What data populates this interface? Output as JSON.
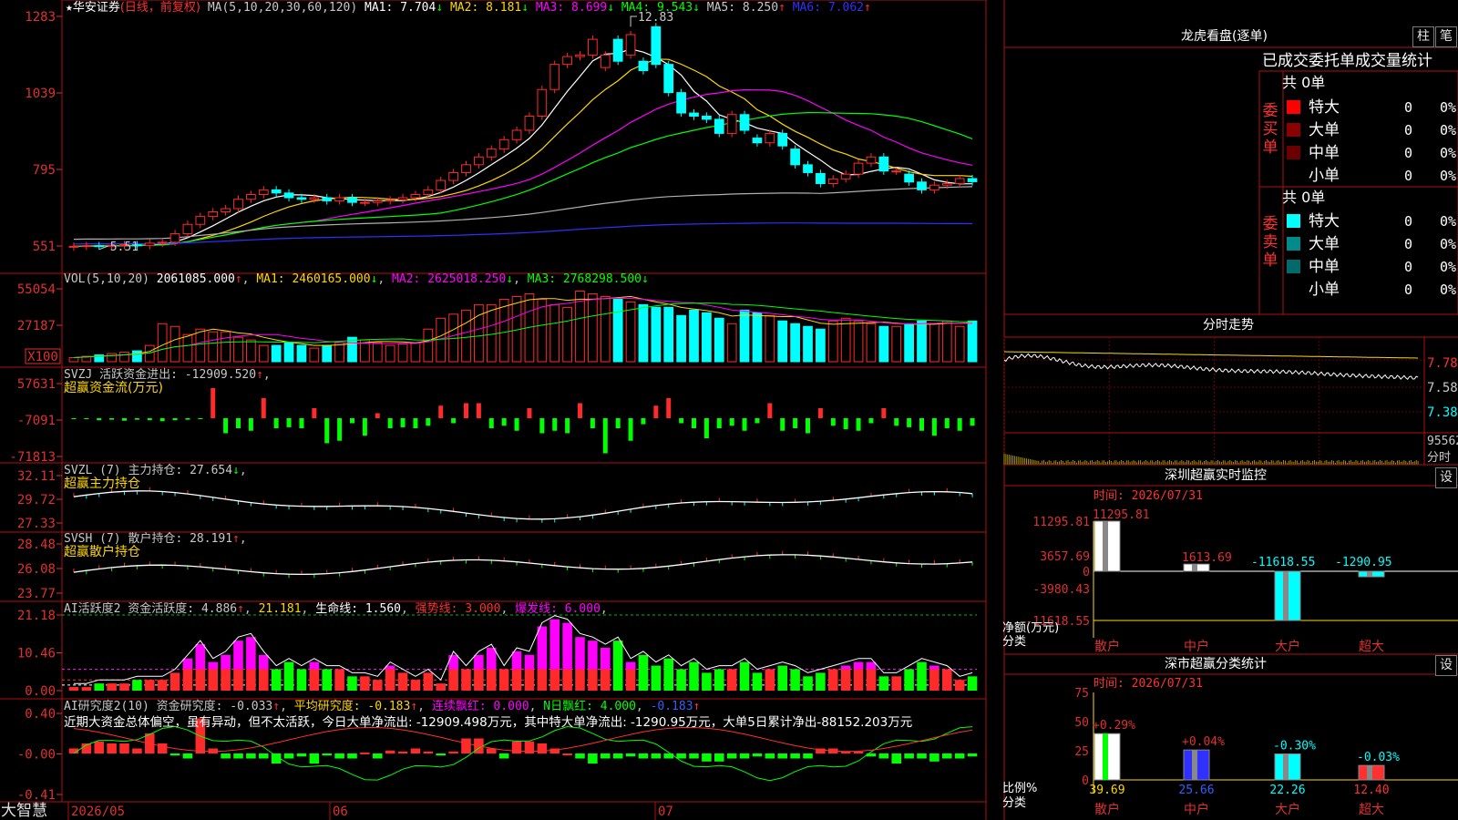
{
  "colors": {
    "up": "#ff2a2a",
    "down": "#00ffff",
    "border": "#b01010",
    "grid": "#6a0000",
    "label": "#e03030",
    "text": "#c8c8c8",
    "yellow": "#ffd700",
    "magenta": "#ff00ff",
    "green": "#00ff00",
    "white": "#ffffff",
    "blue": "#3030ff"
  },
  "header": {
    "star": "★",
    "stock": "华安证券",
    "mode": "(日线，前复权)",
    "ma_title": "MA(5,10,20,30,60,120)",
    "ma1": "MA1: 7.704",
    "ma1_arrow": "↓",
    "ma2": "MA2: 8.181",
    "ma2_arrow": "↓",
    "ma3": "MA3: 8.699",
    "ma3_arrow": "↓",
    "ma4": "MA4: 9.543",
    "ma4_arrow": "↓",
    "ma5": "MA5: 8.250",
    "ma5_arrow": "↑",
    "ma6": "MA6: 7.062",
    "ma6_arrow": "↑"
  },
  "price_axis": [
    "1283",
    "1039",
    "795",
    "551"
  ],
  "price_high_label": "12.83",
  "price_low_label": "5.51",
  "vol": {
    "title": "VOL(5,10,20)",
    "value": "2061085.000",
    "arrow": "↑",
    "ma1": "MA1: 2460165.000",
    "ma1_arrow": "↓",
    "ma2": "MA2: 2625018.250",
    "ma2_arrow": "↓",
    "ma3": "MA3: 2768298.500",
    "ma3_arrow": "↓",
    "axis": [
      "55054",
      "27187"
    ],
    "unit": "X100"
  },
  "svzj": {
    "title": "SVZJ  活跃资金进出: -12909.520",
    "arrow": "↑",
    "sub": "超赢资金流(万元)",
    "axis": [
      "57631",
      "-7091",
      "-71813"
    ]
  },
  "svzl": {
    "title": "SVZL (7) 主力持仓: 27.654",
    "arrow": "↓",
    "sub": "超赢主力持仓",
    "axis": [
      "32.11",
      "29.72",
      "27.33"
    ]
  },
  "svsh": {
    "title": "SVSH (7) 散户持仓: 28.191",
    "arrow": "↑",
    "sub": "超赢散户持仓",
    "axis": [
      "28.48",
      "26.08",
      "23.77"
    ]
  },
  "ai1": {
    "title": "AI活跃度2 资金活跃度: 4.886",
    "a1": "↑",
    "v2": "21.181",
    "sep": ",",
    "v3": "生命线: 1.560",
    "v4": "强势线: 3.000",
    "v5": "爆发线: 6.000",
    "axis": [
      "21.18",
      "10.46",
      "0.00"
    ]
  },
  "ai2": {
    "title": "AI研究度2(10) 资金研究度: -0.033",
    "a1": "↑",
    "v2": "平均研究度: -0.183",
    "a2": "↑",
    "v3": "连续飘红: 0.000",
    "v4": "N日飘红: 4.000",
    "v5": "-0.183",
    "a5": "↑",
    "comment": "近期大资金总体偏空，虽有异动，但不太活跃，今日大单净流出: -12909.498万元，其中特大单净流出: -1290.95万元，大单5日累计净出-88152.203万元",
    "axis": [
      "0.40",
      "-0.00",
      "-0.41"
    ]
  },
  "footer": {
    "brand": "大智慧",
    "dates": [
      "2026/05",
      "06",
      "07"
    ]
  },
  "right": {
    "lh_title": "龙虎看盘(逐单)",
    "btn_zhu": "柱",
    "btn_bi": "笔",
    "stats_title": "已成交委托单成交量统计",
    "buy_label": "委买单",
    "sell_label": "委卖单",
    "buy_total": "共 0单",
    "sell_total": "共 0单",
    "rows": [
      {
        "name": "特大",
        "v": "0",
        "p": "0%"
      },
      {
        "name": "大单",
        "v": "0",
        "p": "0%"
      },
      {
        "name": "中单",
        "v": "0",
        "p": "0%"
      },
      {
        "name": "小单",
        "v": "0",
        "p": "0%"
      }
    ],
    "intraday_title": "分时走势",
    "intraday_axis": [
      "7.78",
      "7.58",
      "7.38"
    ],
    "intraday_vol": "95562",
    "intraday_unit": "分时",
    "sz_title": "深圳超赢实时监控",
    "sz_time": "时间: 2026/07/31",
    "sz_btn": "设",
    "sz_axis": [
      "11295.81",
      "3657.69",
      "0",
      "-3980.43",
      "-11618.55"
    ],
    "sz_unit": "净额(万元)",
    "sz_cat_label": "分类",
    "cls_title": "深市超赢分类统计",
    "cls_time": "时间: 2026/07/31",
    "cls_btn": "设",
    "cls_axis": [
      "75",
      "50",
      "25",
      "0"
    ],
    "cls_unit": "比例%",
    "cls_cat_label": "分类"
  },
  "chart_data": [
    {
      "type": "candlestick",
      "title": "华安证券(日线，前复权)",
      "open": [
        5.48,
        5.5,
        5.52,
        5.51,
        5.53,
        5.55,
        5.52,
        5.6,
        5.63,
        5.9,
        6.2,
        6.45,
        6.6,
        6.7,
        7.0,
        7.15,
        7.3,
        7.2,
        7.05,
        7.0,
        7.05,
        6.95,
        7.05,
        6.9,
        6.9,
        6.95,
        6.98,
        7.05,
        7.15,
        7.3,
        7.6,
        7.85,
        8.1,
        8.35,
        8.6,
        8.9,
        9.2,
        9.65,
        10.5,
        11.3,
        11.55,
        11.6,
        11.2,
        12.1,
        11.6,
        11.4,
        12.5,
        11.3,
        10.4,
        9.75,
        9.65,
        9.55,
        9.1,
        9.7,
        8.95,
        8.8,
        9.1,
        8.6,
        8.1,
        7.82,
        7.5,
        7.65,
        7.8,
        8.15,
        8.35,
        7.9,
        7.8,
        7.55,
        7.3,
        7.45,
        7.5,
        7.66
      ],
      "close": [
        5.5,
        5.52,
        5.51,
        5.53,
        5.55,
        5.52,
        5.6,
        5.63,
        5.9,
        6.2,
        6.45,
        6.6,
        6.7,
        7.0,
        7.15,
        7.3,
        7.2,
        7.05,
        7.0,
        7.05,
        6.95,
        7.05,
        6.9,
        6.9,
        6.95,
        6.98,
        7.05,
        7.15,
        7.3,
        7.6,
        7.85,
        8.1,
        8.35,
        8.6,
        8.9,
        9.2,
        9.65,
        10.5,
        11.3,
        11.55,
        11.6,
        12.1,
        11.6,
        11.4,
        12.25,
        11.1,
        11.3,
        10.4,
        9.75,
        9.65,
        9.55,
        9.1,
        9.7,
        9.2,
        8.8,
        9.1,
        8.7,
        8.1,
        7.85,
        7.5,
        7.65,
        7.8,
        8.15,
        8.35,
        7.9,
        7.9,
        7.55,
        7.3,
        7.45,
        7.5,
        7.66,
        7.56
      ],
      "ylim": [
        5.51,
        12.83
      ]
    },
    {
      "type": "bar",
      "title": "VOL(5,10,20)",
      "series": [
        {
          "name": "VOL",
          "values": [
            3,
            4,
            5,
            6,
            7,
            8,
            12,
            28,
            26,
            20,
            24,
            22,
            22,
            18,
            16,
            12,
            12,
            14,
            12,
            10,
            12,
            14,
            18,
            16,
            14,
            12,
            13,
            14,
            24,
            32,
            35,
            38,
            42,
            42,
            46,
            48,
            50,
            46,
            42,
            40,
            52,
            50,
            48,
            46,
            44,
            42,
            40,
            40,
            34,
            38,
            36,
            32,
            28,
            38,
            36,
            34,
            30,
            28,
            26,
            24,
            30,
            32,
            30,
            28,
            26,
            26,
            28,
            30,
            28,
            30,
            26,
            30
          ]
        }
      ],
      "unit": "X100",
      "axis_max": 55054
    },
    {
      "type": "bar",
      "title": "SVZJ 活跃资金进出",
      "series": [
        {
          "name": "超赢资金流(万元)",
          "values": [
            -2,
            -2,
            -4,
            -3,
            -5,
            -3,
            -4,
            -6,
            -4,
            -3,
            -2,
            60,
            -30,
            -20,
            -25,
            40,
            -20,
            -18,
            -20,
            20,
            -50,
            -45,
            -10,
            -35,
            10,
            -20,
            -18,
            -20,
            -15,
            25,
            -10,
            30,
            30,
            -20,
            -15,
            -25,
            20,
            -30,
            -25,
            -30,
            30,
            -20,
            -70,
            -20,
            -45,
            -12,
            25,
            40,
            -10,
            -20,
            -40,
            -20,
            -15,
            -25,
            -10,
            30,
            -25,
            -20,
            -30,
            20,
            -15,
            -22,
            -25,
            -10,
            20,
            -15,
            -18,
            -25,
            -35,
            -20,
            -25,
            -15,
            -12,
            -25
          ]
        }
      ],
      "axis": [
        57631,
        -7091,
        -71813
      ]
    },
    {
      "type": "line",
      "title": "SVZL (7) 主力持仓",
      "axis": [
        32.11,
        29.72,
        27.33
      ]
    },
    {
      "type": "line",
      "title": "SVSH (7) 散户持仓",
      "axis": [
        28.48,
        26.08,
        23.77
      ]
    },
    {
      "type": "bar",
      "title": "AI活跃度2 资金活跃度",
      "series": [
        {
          "name": "资金活跃度",
          "values": [
            1,
            1,
            2,
            2,
            2,
            3,
            3,
            3,
            5,
            9,
            13,
            8,
            10,
            14,
            15,
            10,
            6,
            8,
            6,
            8,
            6,
            6,
            4,
            4,
            3,
            7,
            5,
            3,
            5,
            2,
            10,
            6,
            10,
            12,
            6,
            11,
            10,
            18,
            20,
            19,
            15,
            14,
            12,
            14,
            8,
            10,
            7,
            9,
            6,
            8,
            5,
            6,
            6,
            8,
            5,
            6,
            7,
            6,
            4,
            5,
            6,
            7,
            8,
            8,
            4,
            4,
            6,
            8,
            7,
            6,
            3,
            4
          ]
        }
      ],
      "axis": [
        21.18,
        10.46,
        0.0
      ]
    },
    {
      "type": "bar",
      "title": "AI研究度2(10) 资金研究度",
      "series": [
        {
          "name": "资金研究度",
          "values": [
            0.05,
            0.1,
            0.12,
            0.1,
            0.1,
            0.05,
            0.2,
            0.1,
            -0.02,
            -0.05,
            0.35,
            0.05,
            -0.05,
            -0.05,
            -0.05,
            -0.05,
            -0.1,
            -0.05,
            -0.03,
            -0.1,
            -0.02,
            -0.05,
            -0.05,
            0.01,
            -0.05,
            0.03,
            0.02,
            0.05,
            0.02,
            -0.02,
            0.02,
            0.15,
            0.15,
            0.05,
            -0.05,
            0.12,
            0.12,
            0.1,
            0.05,
            0.0,
            -0.05,
            -0.1,
            -0.05,
            -0.05,
            -0.03,
            -0.05,
            -0.05,
            -0.05,
            -0.05,
            -0.05,
            -0.08,
            -0.08,
            -0.05,
            -0.05,
            -0.03,
            -0.05,
            -0.05,
            -0.05,
            -0.05,
            0.05,
            0.05,
            0.02,
            0.02,
            -0.03,
            -0.05,
            -0.1,
            -0.05,
            -0.05,
            -0.08,
            -0.05,
            -0.05,
            -0.03
          ]
        }
      ],
      "axis": [
        0.4,
        -0.0,
        -0.41
      ]
    },
    {
      "type": "bar",
      "title": "深圳超赢实时监控",
      "categories": [
        "散户",
        "中户",
        "大户",
        "超大"
      ],
      "values": [
        11295.81,
        1613.69,
        -11618.55,
        -1290.95
      ],
      "value_labels": [
        "11295.81",
        "1613.69",
        "-11618.55",
        "-1290.95"
      ],
      "colors": [
        "#ffffff",
        "#ffffff",
        "#00ffff",
        "#00ffff"
      ],
      "ylim": [
        -11618.55,
        11295.81
      ]
    },
    {
      "type": "bar",
      "title": "深市超赢分类统计",
      "categories": [
        "散户",
        "中户",
        "大户",
        "超大"
      ],
      "values": [
        39.69,
        25.66,
        22.26,
        12.4
      ],
      "value_labels": [
        "39.69",
        "25.66",
        "22.26",
        "12.40"
      ],
      "changes": [
        "+0.29%",
        "+0.04%",
        "-0.30%",
        "-0.03%"
      ],
      "colors": [
        "#ffffff",
        "#3030ff",
        "#00ffff",
        "#ff3030"
      ],
      "ylim": [
        0,
        75
      ]
    }
  ]
}
